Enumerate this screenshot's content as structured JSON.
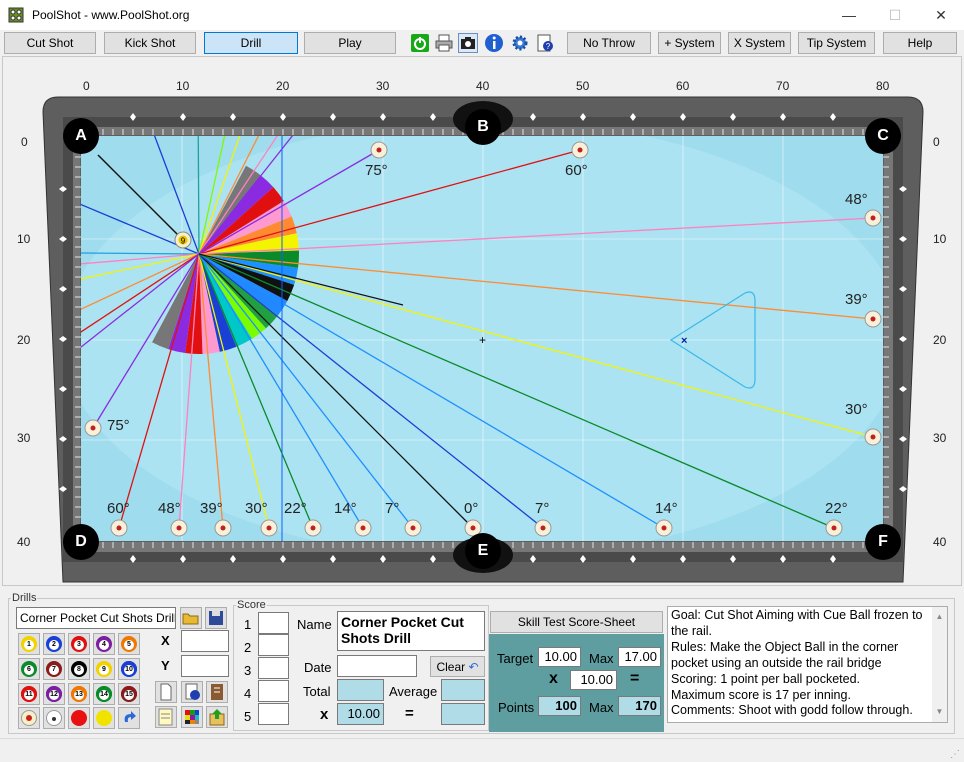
{
  "window": {
    "title": "PoolShot - www.PoolShot.org",
    "min": "—",
    "max": "☐",
    "close": "✕"
  },
  "toolbar": {
    "cut_shot": "Cut Shot",
    "kick_shot": "Kick Shot",
    "drill": "Drill",
    "play": "Play",
    "no_throw_lines": "No Throw Lines",
    "plus_system": "+ System",
    "x_system": "X System",
    "tip_system": "Tip System",
    "help": "Help",
    "icons": [
      "power-icon",
      "printer-icon",
      "camera-icon",
      "info-icon",
      "gear-icon",
      "help-document-icon"
    ]
  },
  "table": {
    "x_axis": [
      "0",
      "10",
      "20",
      "30",
      "40",
      "50",
      "60",
      "70",
      "80"
    ],
    "y_axis": [
      "0",
      "10",
      "20",
      "30",
      "40"
    ],
    "pockets": [
      "A",
      "B",
      "C",
      "D",
      "E",
      "F"
    ],
    "cue_ball_number": "9",
    "angle_labels": [
      "75°",
      "60°",
      "48°",
      "39°",
      "30°",
      "75°",
      "60°",
      "48°",
      "39°",
      "30°",
      "22°",
      "14°",
      "7°",
      "0°",
      "7°",
      "14°",
      "22°"
    ]
  },
  "drills": {
    "legend": "Drills",
    "drill_name": "Corner Pocket Cut Shots Drill",
    "x_label": "X",
    "y_label": "Y",
    "x_value": "",
    "y_value": "",
    "balls": [
      "1",
      "2",
      "3",
      "4",
      "5",
      "6",
      "7",
      "8",
      "9",
      "10",
      "11",
      "12",
      "13",
      "14",
      "15"
    ],
    "ball_colors": [
      "#f2d200",
      "#1a3fd6",
      "#e01010",
      "#7a1fa0",
      "#f07800",
      "#0a8a2a",
      "#8b1a1a",
      "#000000",
      "#f2d200",
      "#1a3fd6",
      "#e01010",
      "#7a1fa0",
      "#f07800",
      "#0a8a2a",
      "#8b1a1a"
    ]
  },
  "score": {
    "legend": "Score",
    "rows": [
      "1",
      "2",
      "3",
      "4",
      "5"
    ],
    "name_label": "Name",
    "name_value": "Corner Pocket Cut Shots Drill",
    "date_label": "Date",
    "date_value": "",
    "clear_label": "Clear",
    "total_label": "Total",
    "average_label": "Average",
    "x_label": "x",
    "x_value": "10.00",
    "eq_label": "="
  },
  "skill": {
    "button": "Skill Test Score-Sheet",
    "target_label": "Target",
    "target_value": "10.00",
    "max_label": "Max",
    "max_value": "17.00",
    "x_label": "x",
    "x_value": "10.00",
    "eq": "=",
    "points_label": "Points",
    "points_value": "100",
    "max2_label": "Max",
    "max2_value": "170"
  },
  "notes": {
    "lines": [
      "Goal: Cut Shot Aiming with Cue Ball frozen to the rail.",
      "Rules: Make the Object Ball in the corner pocket using an outside the rail bridge",
      "Scoring: 1 point per ball pocketed.",
      "Maximum score is 17 per inning.",
      "Comments: Shoot with godd follow through."
    ]
  },
  "colors": {
    "felt": "#8fd3e8",
    "rail": "#5a5a5a",
    "accent": "#0078d7"
  }
}
